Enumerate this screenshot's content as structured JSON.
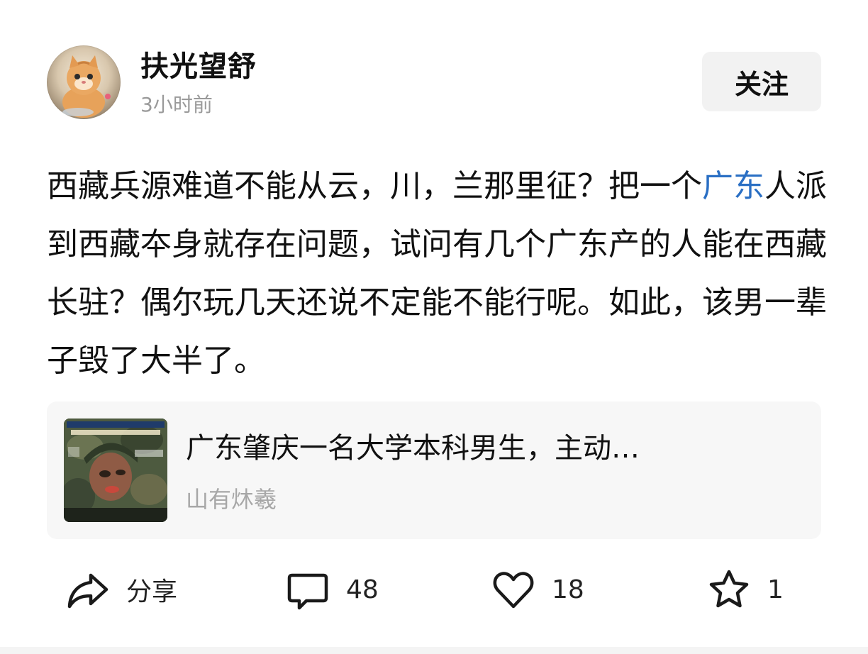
{
  "author": {
    "name": "扶光望舒",
    "time": "3小时前",
    "avatar_icon": "cat-avatar-icon"
  },
  "follow_button": {
    "label": "关注"
  },
  "post": {
    "text_before_link": "西藏兵源难道不能从云，川，兰那里征？把一个",
    "link_text": "广东",
    "text_after_link": "人派到西藏夲身就存在问题，试问有几个广东产的人能在西藏长驻？偶尔玩几天还说不定能不能行呢。如此，该男一辈子毁了大半了。",
    "link_color": "#2a6fc4"
  },
  "linked_card": {
    "title": "广东肇庆一名大学本科男生，主动…",
    "source": "山有炑羲",
    "thumbnail_icon": "news-thumbnail-image"
  },
  "actions": {
    "share": {
      "label": "分享",
      "icon": "share-icon"
    },
    "comment": {
      "label": "48",
      "icon": "comment-icon"
    },
    "like": {
      "label": "18",
      "icon": "heart-icon"
    },
    "favorite": {
      "label": "1",
      "icon": "star-icon"
    }
  }
}
